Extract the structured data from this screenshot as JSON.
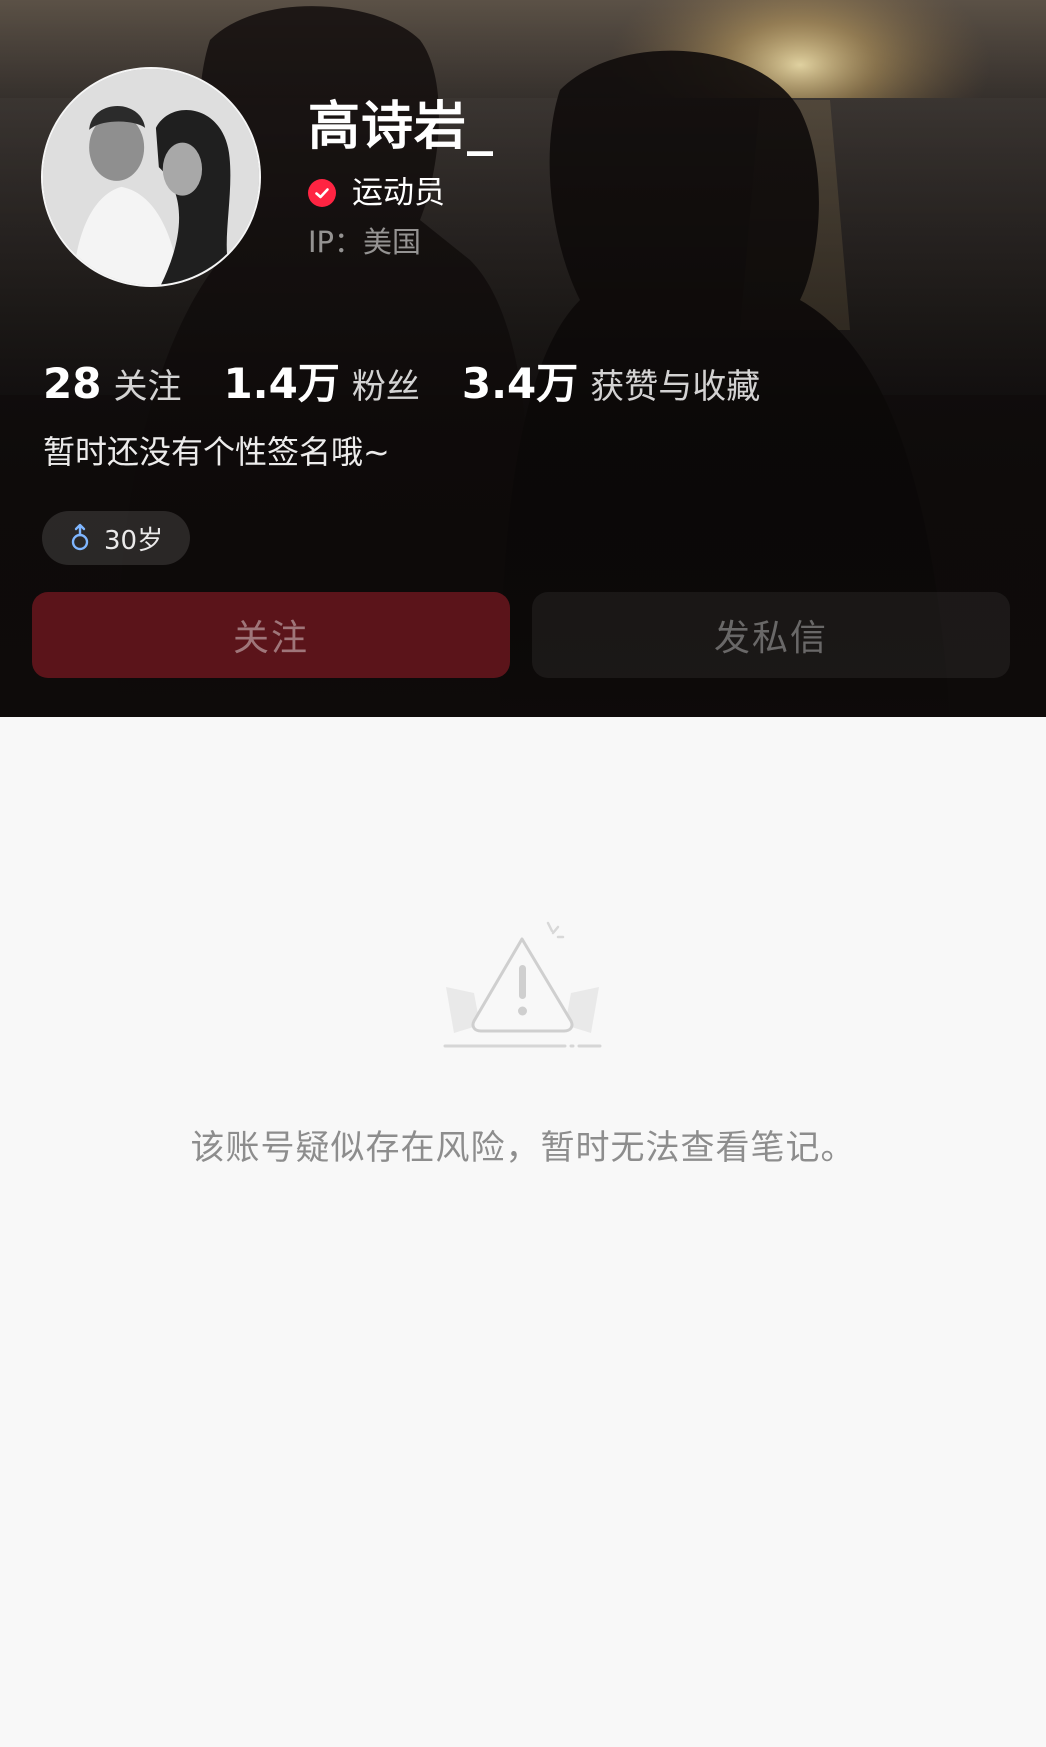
{
  "profile": {
    "username": "高诗岩_",
    "verified_label": "运动员",
    "ip_label": "IP：美国",
    "bio": "暂时还没有个性签名哦~",
    "tag": {
      "icon": "male-icon",
      "text": "30岁"
    }
  },
  "stats": [
    {
      "value": "28",
      "label": "关注"
    },
    {
      "value": "1.4万",
      "label": "粉丝"
    },
    {
      "value": "3.4万",
      "label": "获赞与收藏"
    }
  ],
  "actions": {
    "follow_label": "关注",
    "message_label": "发私信"
  },
  "empty_state": {
    "icon": "warning-icon",
    "message": "该账号疑似存在风险，暂时无法查看笔记。"
  },
  "colors": {
    "accent": "#ff2442",
    "follow_button": "#5b141a",
    "background": "#f8f8f8"
  }
}
